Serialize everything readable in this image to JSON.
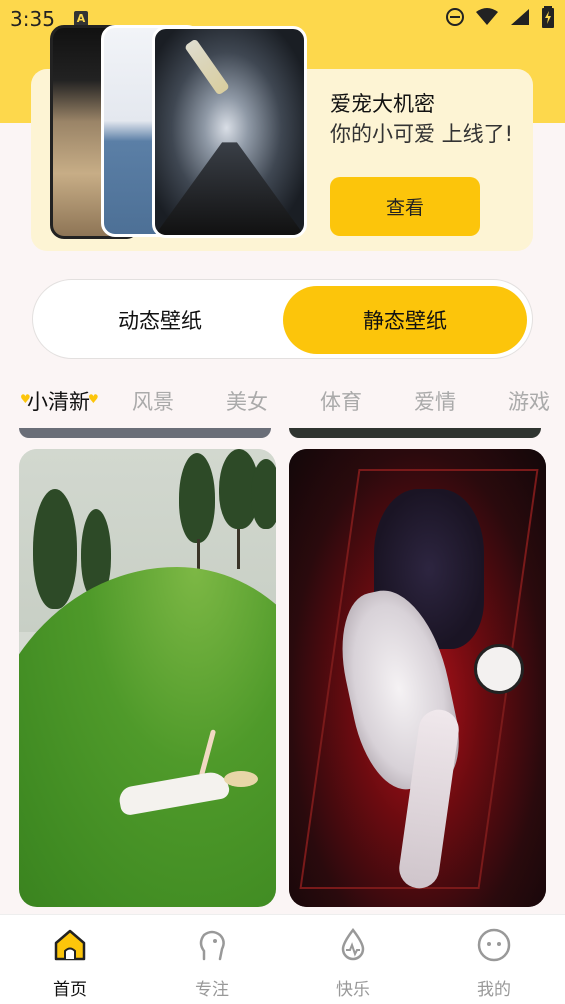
{
  "status_bar": {
    "time": "3:35",
    "badge": "A"
  },
  "banner": {
    "title": "爱宠大机密",
    "subtitle": "你的小可爱 上线了!",
    "button_label": "查看"
  },
  "segment": {
    "left_label": "动态壁纸",
    "right_label": "静态壁纸",
    "selected": "静态壁纸"
  },
  "categories": [
    "小清新",
    "风景",
    "美女",
    "体育",
    "爱情",
    "游戏"
  ],
  "active_category": "小清新",
  "nav": {
    "items": [
      {
        "label": "首页",
        "icon": "home-icon",
        "active": true
      },
      {
        "label": "专注",
        "icon": "focus-head-icon",
        "active": false
      },
      {
        "label": "快乐",
        "icon": "drop-pulse-icon",
        "active": false
      },
      {
        "label": "我的",
        "icon": "face-icon",
        "active": false
      }
    ]
  },
  "colors": {
    "accent": "#fcc50b",
    "top_band": "#fdd84c",
    "banner_bg": "#fdf4d4"
  }
}
